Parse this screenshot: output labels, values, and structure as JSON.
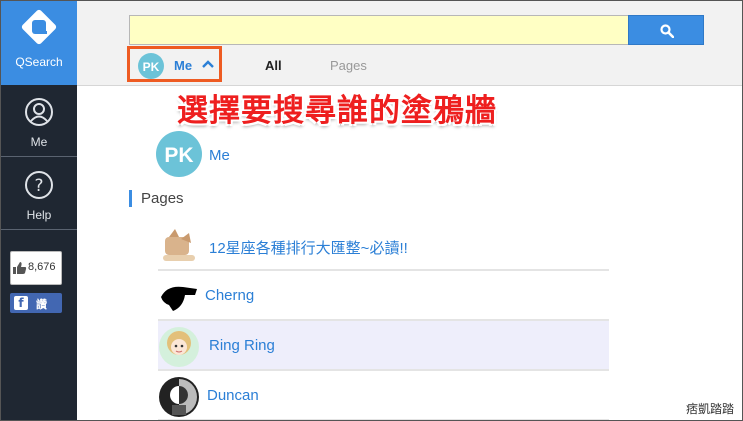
{
  "sidebar": {
    "logo_label": "QSearch",
    "items": [
      {
        "label": "Me",
        "icon": "user-icon"
      },
      {
        "label": "Help",
        "icon": "help-icon"
      }
    ],
    "like_count": "8,676",
    "fb_button_label": "讚"
  },
  "search": {
    "value": "",
    "placeholder": ""
  },
  "tabs": {
    "me_avatar_text": "PK",
    "me_label": "Me",
    "all_label": "All",
    "pages_label": "Pages"
  },
  "caption": "選擇要搜尋誰的塗鴉牆",
  "me_result": {
    "avatar_text": "PK",
    "name": "Me"
  },
  "pages_heading": "Pages",
  "pages": [
    {
      "name": "12星座各種排行大匯整~必讀!!",
      "highlighted": false
    },
    {
      "name": "Cherng",
      "highlighted": false
    },
    {
      "name": "Ring Ring",
      "highlighted": true
    },
    {
      "name": "Duncan",
      "highlighted": false
    }
  ],
  "watermark": "痞凱踏踏",
  "colors": {
    "accent": "#3b8de2",
    "sidebar_bg": "#1f2732",
    "highlight_border": "#ee5b22",
    "caption": "#ee1f1f",
    "search_bg": "#ffffc4"
  }
}
